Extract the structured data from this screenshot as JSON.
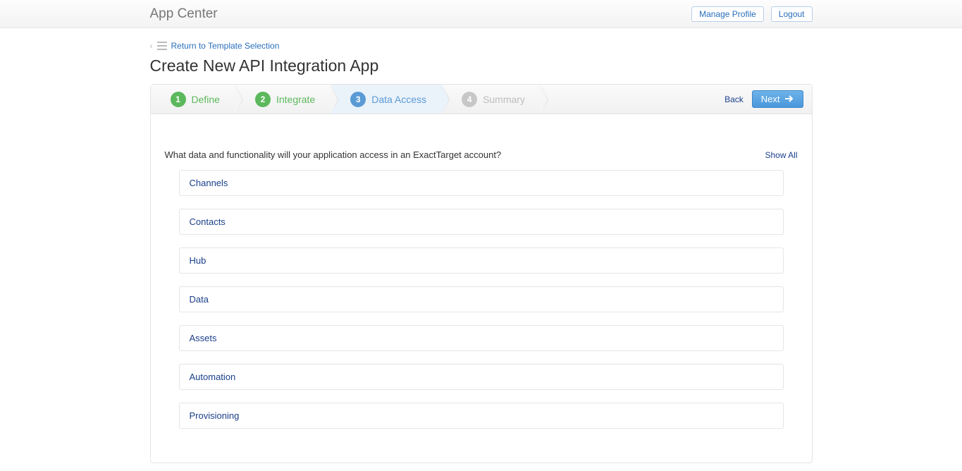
{
  "header": {
    "brand": "App Center",
    "manage_profile": "Manage Profile",
    "logout": "Logout"
  },
  "return_link": "Return to Template Selection",
  "page_title": "Create New API Integration App",
  "steps": [
    {
      "num": "1",
      "label": "Define",
      "state": "done"
    },
    {
      "num": "2",
      "label": "Integrate",
      "state": "done"
    },
    {
      "num": "3",
      "label": "Data Access",
      "state": "active"
    },
    {
      "num": "4",
      "label": "Summary",
      "state": "upcoming"
    }
  ],
  "nav": {
    "back": "Back",
    "next": "Next"
  },
  "prompt": "What data and functionality will your application access in an ExactTarget account?",
  "show_all": "Show All",
  "categories": [
    "Channels",
    "Contacts",
    "Hub",
    "Data",
    "Assets",
    "Automation",
    "Provisioning"
  ]
}
